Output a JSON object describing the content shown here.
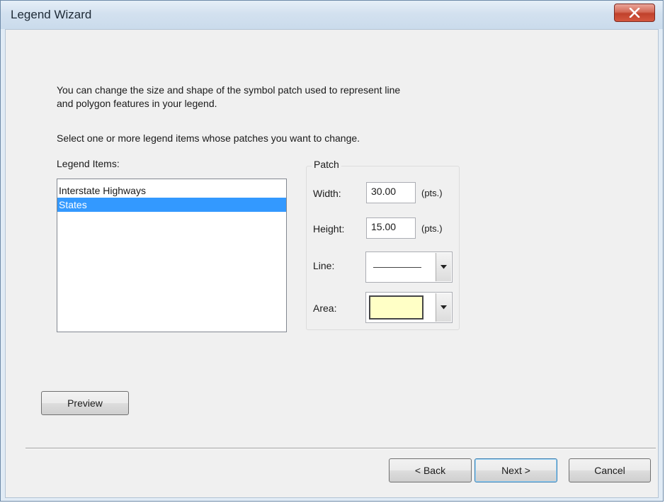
{
  "window": {
    "title": "Legend Wizard"
  },
  "intro": {
    "text_line1": "You can change the size and shape of the symbol patch used to represent line",
    "text_line2": "and polygon features in your legend.",
    "select_text": "Select one or more legend items whose patches you want to change."
  },
  "legend_items": {
    "label": "Legend Items:",
    "items": [
      {
        "label": "Interstate Highways",
        "selected": false
      },
      {
        "label": "States",
        "selected": true
      }
    ]
  },
  "patch": {
    "group_label": "Patch",
    "width": {
      "label": "Width:",
      "value": "30.00",
      "unit": "(pts.)"
    },
    "height": {
      "label": "Height:",
      "value": "15.00",
      "unit": "(pts.)"
    },
    "line": {
      "label": "Line:"
    },
    "area": {
      "label": "Area:",
      "fill_color": "#ffffc6"
    }
  },
  "buttons": {
    "preview": "Preview",
    "back": "< Back",
    "next": "Next >",
    "cancel": "Cancel"
  },
  "colors": {
    "selection": "#3399ff",
    "close_button": "#c0412c"
  },
  "icons": {
    "close": "close-x-icon",
    "dropdown": "chevron-down-icon"
  }
}
